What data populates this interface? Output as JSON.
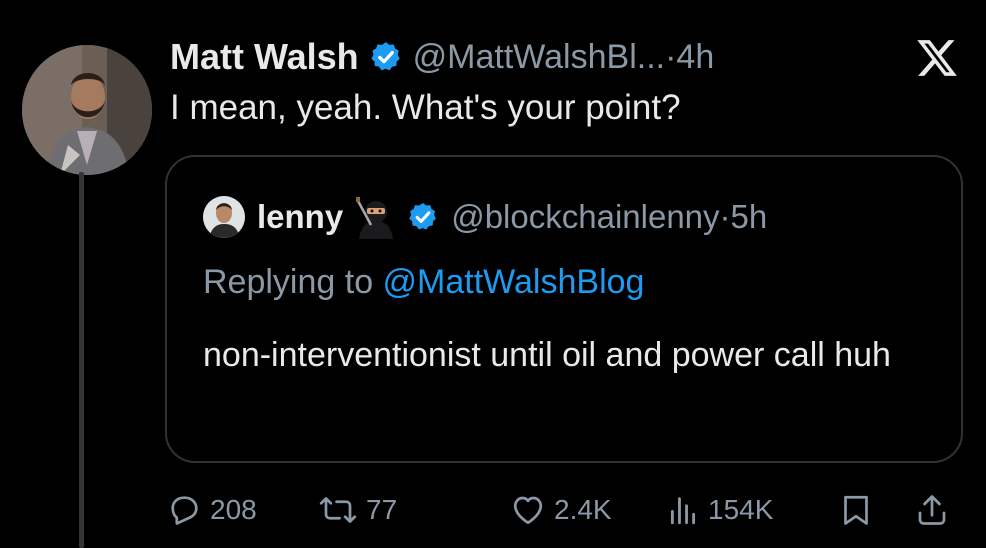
{
  "tweet": {
    "author_name": "Matt Walsh",
    "author_handle": "@MattWalshBl...",
    "separator": "·",
    "time": "4h",
    "text": "I mean, yeah. What's your point?"
  },
  "quoted_tweet": {
    "author_name": "lenny",
    "author_handle": "@blockchainlenny",
    "separator": "·",
    "time": "5h",
    "replying_prefix": "Replying to ",
    "replying_handle": "@MattWalshBlog",
    "text": "non-interventionist until oil and power call huh"
  },
  "actions": {
    "replies": "208",
    "retweets": "77",
    "likes": "2.4K",
    "views": "154K"
  },
  "colors": {
    "background": "#000000",
    "primary_text": "#e7e9ea",
    "secondary_text": "#8b98a5",
    "accent": "#1d9bf0",
    "border": "#2f3336"
  },
  "icons": [
    "x-logo-icon",
    "verified-badge-icon",
    "ninja-emoji-icon",
    "reply-icon",
    "retweet-icon",
    "like-icon",
    "views-icon",
    "bookmark-icon",
    "share-icon"
  ]
}
